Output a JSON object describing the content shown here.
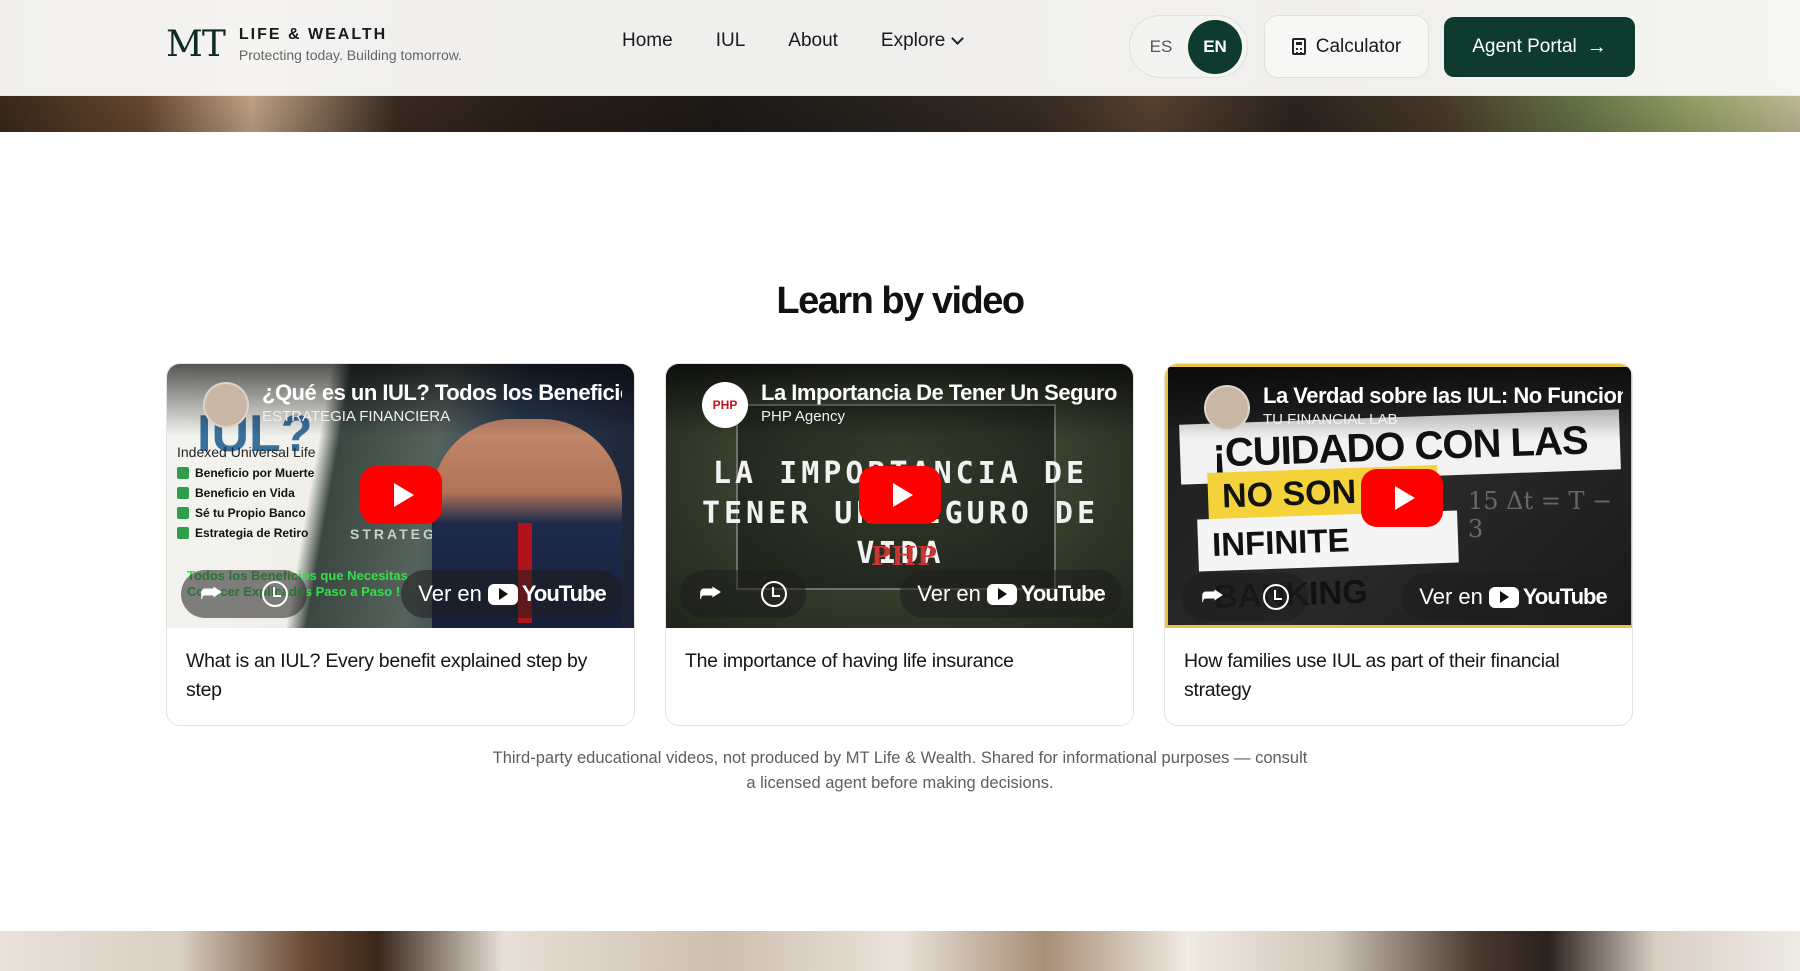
{
  "header": {
    "logo_mark": "MT",
    "brand_name": "LIFE & WEALTH",
    "tagline": "Protecting today. Building tomorrow.",
    "nav": [
      "Home",
      "IUL",
      "About",
      "Explore"
    ],
    "lang_options": [
      "ES",
      "EN"
    ],
    "lang_selected": "EN",
    "calculator_label": "Calculator",
    "agent_portal_label": "Agent Portal"
  },
  "section": {
    "title": "Learn by video",
    "disclaimer_line1": "Third-party educational videos, not produced by MT Life & Wealth. Shared for informational purposes — consult",
    "disclaimer_line2": "a licensed agent before making decisions."
  },
  "videos": [
    {
      "yt_title": "¿Qué es un IUL? Todos los Beneficio",
      "channel": "ESTRATEGIA FINANCIERA",
      "thumb_text": {
        "big": "IUL?",
        "subtitle": "Indexed Universal Life",
        "checks": [
          "Beneficio por Muerte",
          "Beneficio en Vida",
          "Sé tu Propio Banco",
          "Estrategia de Retiro"
        ],
        "strategy": "STRATEGY",
        "caption_line1": "Todos los Beneficios que Necesitas",
        "caption_line2": "Conocer Explicados Paso a Paso !"
      },
      "ver_en": "Ver en",
      "caption": "What is an IUL? Every benefit explained step by step"
    },
    {
      "yt_title": "La Importancia De Tener Un Seguro",
      "channel": "PHP Agency",
      "avatar_text": "PHP",
      "thumb_text": {
        "line1": "LA IMPORTANCIA DE",
        "line2": "TENER UN SEGURO DE VIDA",
        "logo": "PHP"
      },
      "ver_en": "Ver en",
      "caption": "The importance of having life insurance"
    },
    {
      "yt_title": "La Verdad sobre las IUL: No Funcion",
      "channel": "TU FINANCIAL LAB",
      "thumb_text": {
        "head": "¡CUIDADO CON LAS IUL!",
        "yellow": "NO SON PARA",
        "white": "INFINITE BANKING",
        "chalk": "15 Δt = T − 3"
      },
      "ver_en": "Ver en",
      "caption": "How families use IUL as part of their financial strategy"
    }
  ],
  "youtube_word": "YouTube",
  "colors": {
    "brand_green": "#0f3a2f",
    "youtube_red": "#ff0000",
    "check_green": "#2f9e4a",
    "caption_green": "#33e04a",
    "warning_yellow": "#f3d23a"
  }
}
